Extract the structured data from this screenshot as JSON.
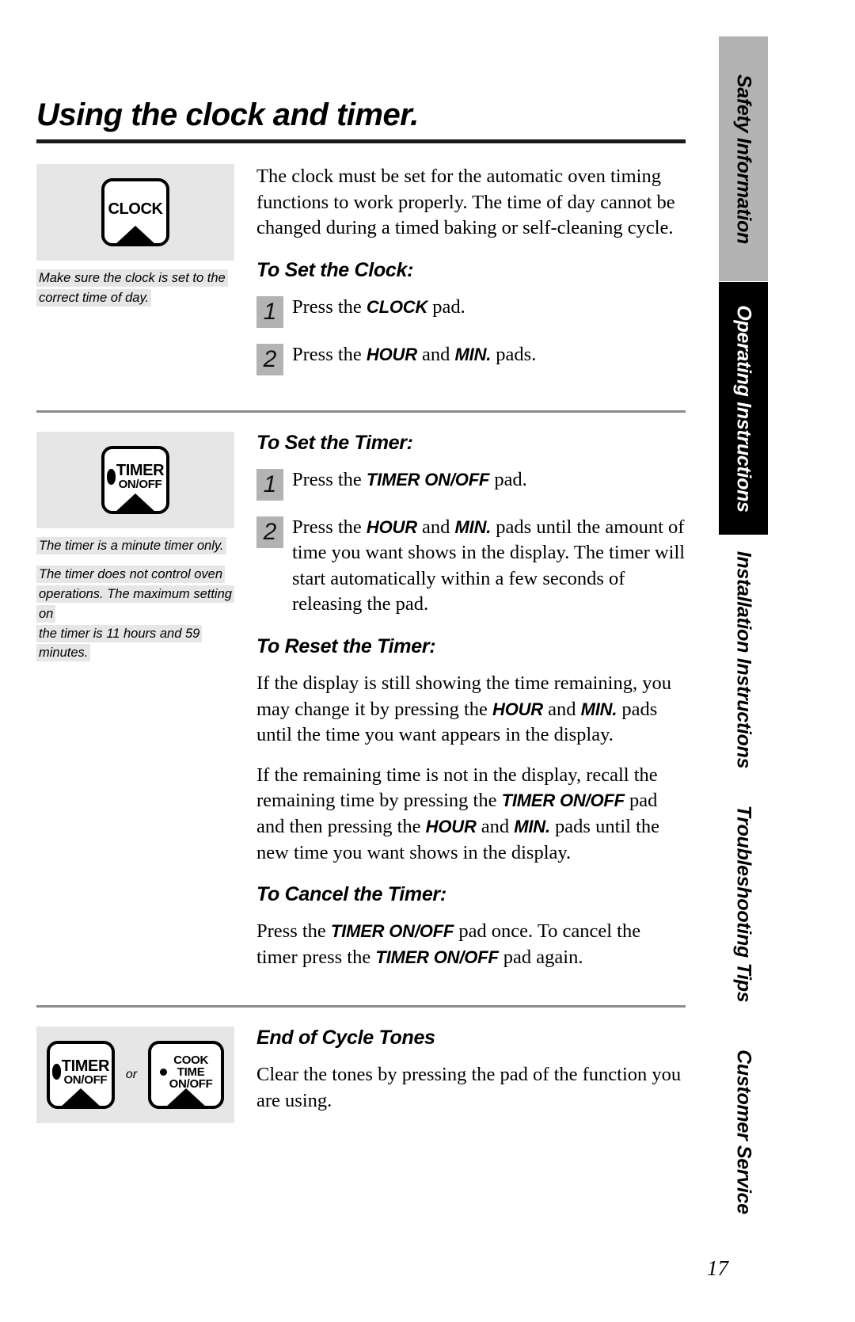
{
  "page": {
    "heading": "Using the clock and timer.",
    "number": "17"
  },
  "side_tabs": [
    {
      "label": "Safety Information",
      "style": "grey"
    },
    {
      "label": "Operating Instructions",
      "style": "black"
    },
    {
      "label": "Installation Instructions",
      "style": "white"
    },
    {
      "label": "Troubleshooting Tips",
      "style": "white"
    },
    {
      "label": "Customer Service",
      "style": "white"
    }
  ],
  "clock_section": {
    "pad": {
      "line1": "CLOCK"
    },
    "caption_line1": "Make sure the clock is set to the",
    "caption_line2": "correct time of day.",
    "intro": "The clock must be set for the automatic oven timing functions to work properly. The time of day cannot be changed during a timed baking or self-cleaning cycle.",
    "heading": "To Set the Clock:",
    "steps": [
      {
        "num": "1",
        "pre": "Press the ",
        "bold": "CLOCK",
        "post": " pad."
      },
      {
        "num": "2",
        "pre": "Press the ",
        "bold": "HOUR",
        "mid": " and ",
        "bold2": "MIN.",
        "post": " pads."
      }
    ]
  },
  "timer_section": {
    "pad": {
      "line1": "TIMER",
      "line2": "ON/OFF"
    },
    "caption_p1": "The timer is a minute timer only.",
    "caption_p2_l1": "The timer does not control oven",
    "caption_p2_l2": "operations. The maximum setting on",
    "caption_p2_l3": "the timer is 11 hours and 59 minutes.",
    "set_heading": "To Set the Timer:",
    "set_step1": {
      "num": "1",
      "pre": "Press the ",
      "bold": "TIMER ON/OFF",
      "post": " pad."
    },
    "set_step2": {
      "num": "2",
      "pre": "Press the ",
      "bold": "HOUR",
      "mid": " and ",
      "bold2": "MIN.",
      "post": " pads until the amount of time you want shows in the display. The timer will start automatically within a few seconds of releasing the pad."
    },
    "reset_heading": "To Reset the Timer:",
    "reset_p1_a": "If the display is still showing the time remaining, you may change it by pressing the ",
    "reset_p1_b": "HOUR",
    "reset_p1_c": " and ",
    "reset_p1_d": "MIN.",
    "reset_p1_e": " pads until the time you want appears in the display.",
    "reset_p2_a": "If the remaining time is not in the display, recall the remaining time by pressing the ",
    "reset_p2_b": "TIMER ON/OFF",
    "reset_p2_c": " pad and then pressing the ",
    "reset_p2_d": "HOUR",
    "reset_p2_e": " and ",
    "reset_p2_f": "MIN.",
    "reset_p2_g": " pads until the new time you want shows in the display.",
    "cancel_heading": "To Cancel the Timer:",
    "cancel_a": "Press the ",
    "cancel_b": "TIMER ON/OFF",
    "cancel_c": " pad once. To cancel the timer press the ",
    "cancel_d": "TIMER ON/OFF",
    "cancel_e": " pad again."
  },
  "tones_section": {
    "pad_left": {
      "line1": "TIMER",
      "line2": "ON/OFF"
    },
    "or_label": "or",
    "pad_right": {
      "line1": "COOK",
      "line2": "TIME",
      "line3": "ON/OFF"
    },
    "heading": "End of Cycle Tones",
    "body": "Clear the tones by pressing the pad of the function you are using."
  },
  "colors": {
    "art_panel_grey": "#e6e6e6",
    "step_num_grey": "#b3b3b3",
    "tab_grey": "#b3b3b3",
    "tab_black": "#000000",
    "rule_heavy": "#1a1a1a",
    "rule_light": "#8c8c8c"
  }
}
